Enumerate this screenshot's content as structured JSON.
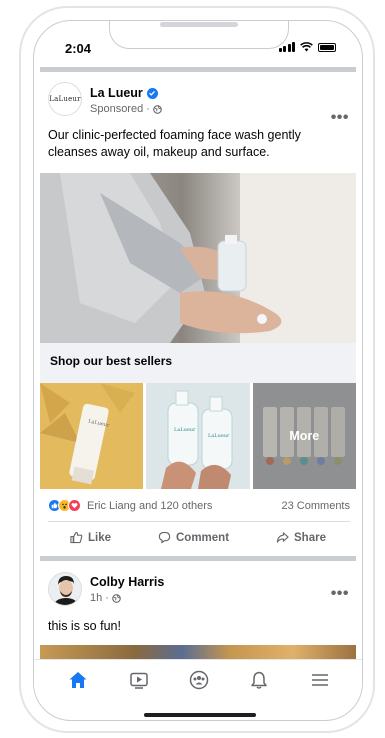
{
  "status_bar": {
    "time": "2:04"
  },
  "post1": {
    "page_name": "La Lueur",
    "logo_text": "LaLueur",
    "sponsored": "Sponsored ·",
    "body": "Our clinic-perfected foaming face wash gently cleanses away oil, makeup and surface.",
    "shop_title": "Shop our best sellers",
    "more_label": "More",
    "reactions_text": "Eric Liang and 120 others",
    "comments_count": "23 Comments",
    "actions": {
      "like": "Like",
      "comment": "Comment",
      "share": "Share"
    }
  },
  "post2": {
    "author": "Colby Harris",
    "time": "1h ·",
    "body": "this is so fun!"
  },
  "colors": {
    "accent": "#1877f2",
    "separator": "#c9ccd1",
    "muted": "#65676b"
  },
  "icons": [
    "verified-icon",
    "globe-icon",
    "more-icon",
    "like-icon",
    "comment-icon",
    "share-icon",
    "home-icon",
    "video-icon",
    "groups-icon",
    "bell-icon",
    "menu-icon"
  ]
}
